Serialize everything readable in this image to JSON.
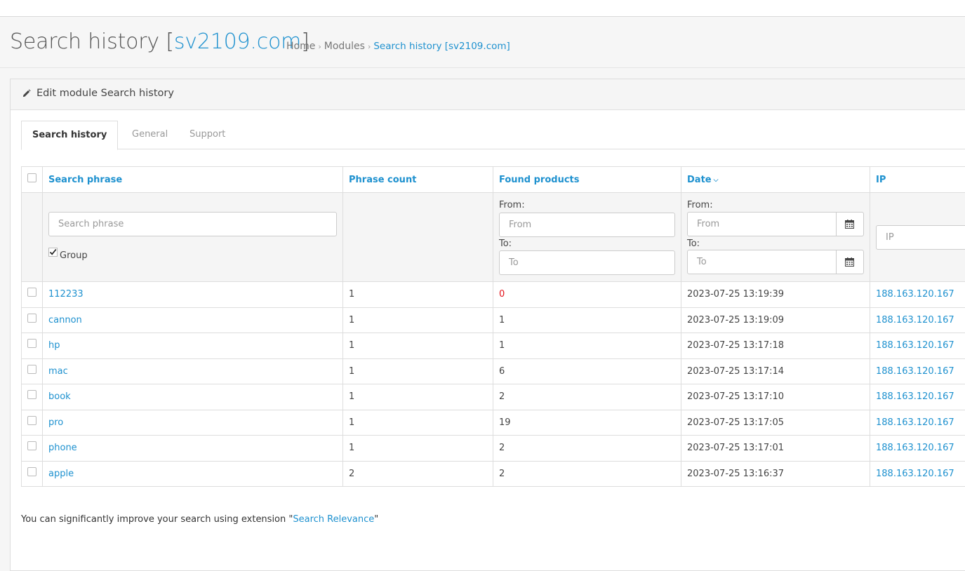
{
  "header": {
    "title_prefix": "Search history [",
    "title_domain": "sv2109.com",
    "title_suffix": "]",
    "breadcrumb": [
      "Home",
      "Modules",
      "Search history [sv2109.com]"
    ]
  },
  "panel": {
    "title": "Edit module Search history"
  },
  "tabs": [
    "Search history",
    "General",
    "Support"
  ],
  "table": {
    "columns": [
      "Search phrase",
      "Phrase count",
      "Found products",
      "Date",
      "IP"
    ],
    "sort_indicator_icon": "chevron-down-icon",
    "filters": {
      "search_placeholder": "Search phrase",
      "group_label": "Group",
      "group_checked": true,
      "from_label": "From:",
      "to_label": "To:",
      "from_placeholder": "From",
      "to_placeholder": "To",
      "ip_placeholder": "IP"
    },
    "rows": [
      {
        "phrase": "112233",
        "count": "1",
        "found": "0",
        "date": "2023-07-25 13:19:39",
        "ip": "188.163.120.167"
      },
      {
        "phrase": "cannon",
        "count": "1",
        "found": "1",
        "date": "2023-07-25 13:19:09",
        "ip": "188.163.120.167"
      },
      {
        "phrase": "hp",
        "count": "1",
        "found": "1",
        "date": "2023-07-25 13:17:18",
        "ip": "188.163.120.167"
      },
      {
        "phrase": "mac",
        "count": "1",
        "found": "6",
        "date": "2023-07-25 13:17:14",
        "ip": "188.163.120.167"
      },
      {
        "phrase": "book",
        "count": "1",
        "found": "2",
        "date": "2023-07-25 13:17:10",
        "ip": "188.163.120.167"
      },
      {
        "phrase": "pro",
        "count": "1",
        "found": "19",
        "date": "2023-07-25 13:17:05",
        "ip": "188.163.120.167"
      },
      {
        "phrase": "phone",
        "count": "1",
        "found": "2",
        "date": "2023-07-25 13:17:01",
        "ip": "188.163.120.167"
      },
      {
        "phrase": "apple",
        "count": "2",
        "found": "2",
        "date": "2023-07-25 13:16:37",
        "ip": "188.163.120.167"
      }
    ]
  },
  "footer": {
    "note_prefix": "You can significantly improve your search using extension \"",
    "note_link": "Search Relevance",
    "note_suffix": "\""
  },
  "colors": {
    "accent": "#1e91cf",
    "zero_highlight": "#e3141c"
  }
}
